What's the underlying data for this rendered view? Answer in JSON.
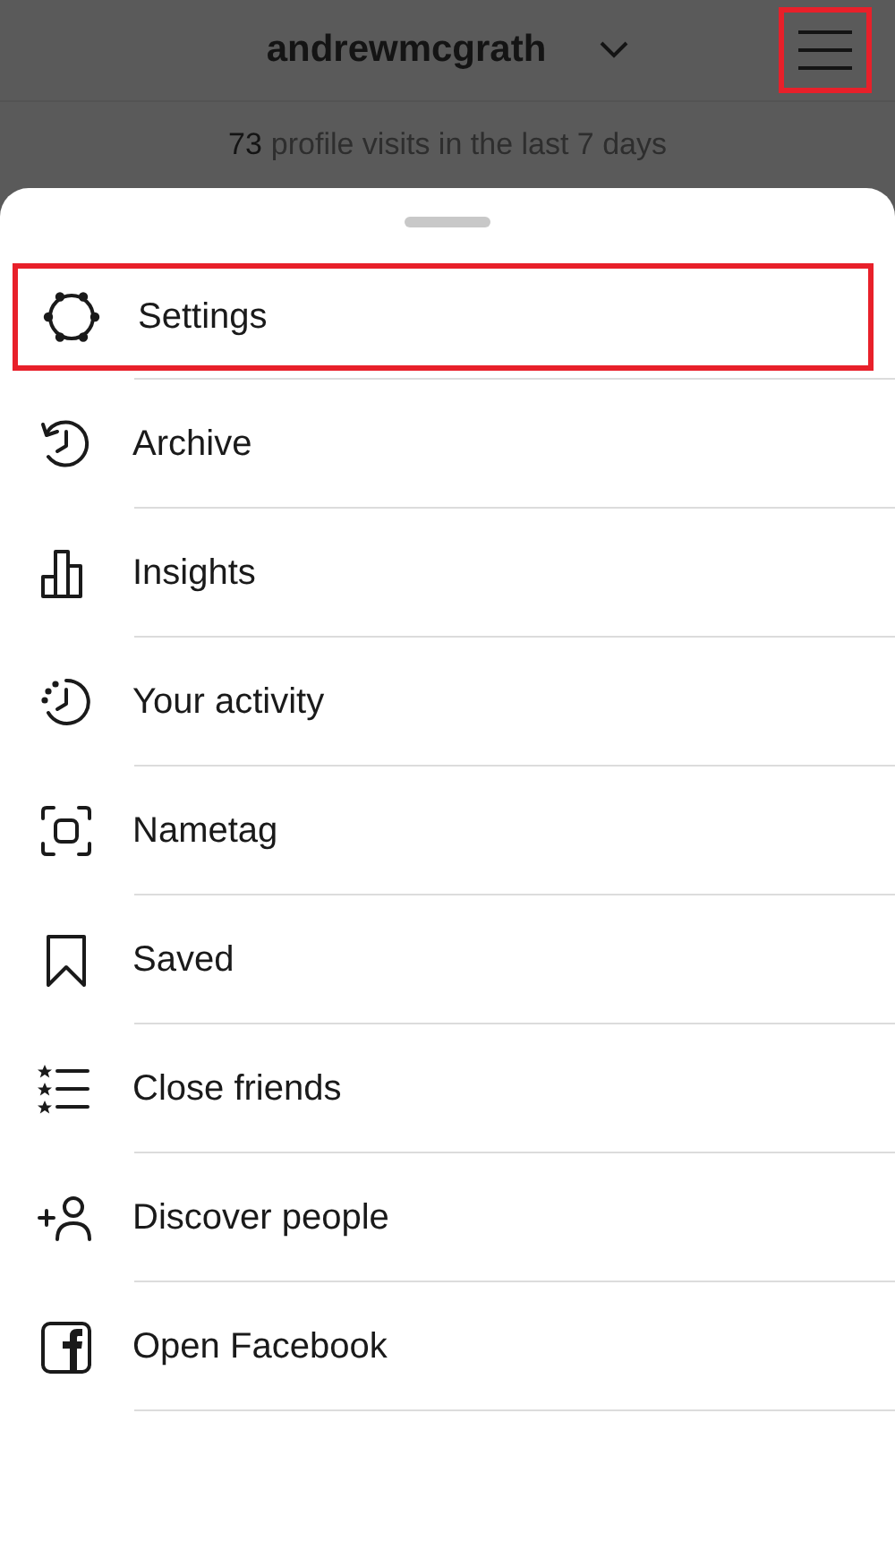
{
  "header": {
    "username": "andrewmcgrath",
    "menu_button": {
      "highlighted": true
    }
  },
  "visits": {
    "count": "73",
    "text": "profile visits in the last 7 days"
  },
  "menu": [
    {
      "kind": "settings",
      "label": "Settings",
      "highlighted": true
    },
    {
      "kind": "archive",
      "label": "Archive",
      "highlighted": false
    },
    {
      "kind": "insights",
      "label": "Insights",
      "highlighted": false
    },
    {
      "kind": "activity",
      "label": "Your activity",
      "highlighted": false
    },
    {
      "kind": "nametag",
      "label": "Nametag",
      "highlighted": false
    },
    {
      "kind": "saved",
      "label": "Saved",
      "highlighted": false
    },
    {
      "kind": "friends",
      "label": "Close friends",
      "highlighted": false
    },
    {
      "kind": "discover",
      "label": "Discover people",
      "highlighted": false
    },
    {
      "kind": "facebook",
      "label": "Open Facebook",
      "highlighted": false
    }
  ]
}
